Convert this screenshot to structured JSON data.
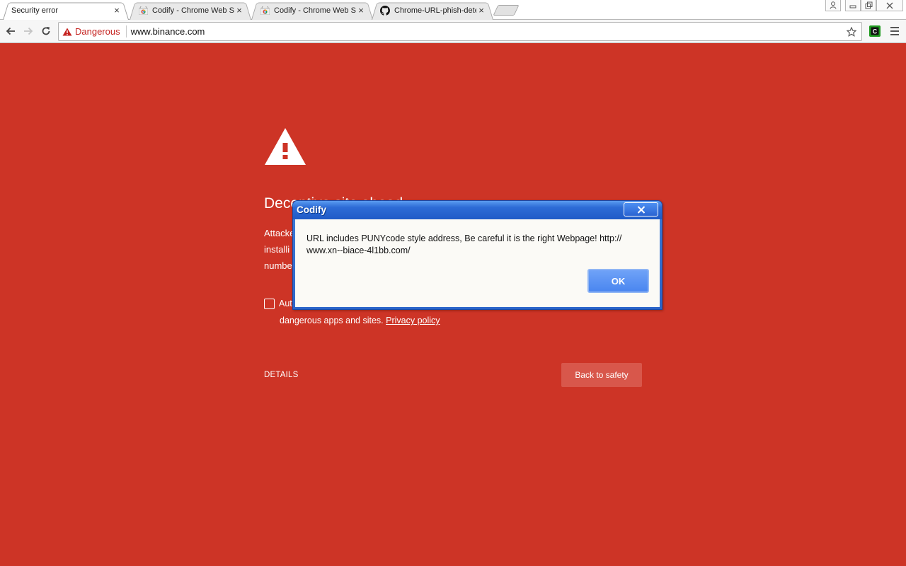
{
  "browser": {
    "tabs": [
      {
        "title": "Security error",
        "active": true
      },
      {
        "title": "Codify - Chrome Web Store",
        "active": false
      },
      {
        "title": "Codify - Chrome Web Store",
        "active": false
      },
      {
        "title": "Chrome-URL-phish-detector",
        "active": false
      }
    ],
    "tab_close_glyph": "×",
    "omnibox": {
      "security_label": "Dangerous",
      "url": "www.binance.com"
    },
    "extension_label": "C"
  },
  "interstitial": {
    "heading": "Deceptive site ahead",
    "body_lines": [
      "Attacke",
      "installi",
      "numbe"
    ],
    "checkbox_line1": "Aut",
    "checkbox_line2": "dangerous apps and sites.",
    "privacy_link": "Privacy policy",
    "details_label": "DETAILS",
    "safety_button": "Back to safety"
  },
  "dialog": {
    "title": "Codify",
    "message_line1": "URL includes PUNYcode style address, Be careful it is the right Webpage! http://",
    "message_line2": "www.xn--biace-4l1bb.com/",
    "ok_label": "OK"
  },
  "colors": {
    "interstitial_bg": "#cd3426",
    "danger_text": "#c5221f",
    "dialog_blue": "#2b64c9"
  },
  "icons": {
    "warning": "warning-triangle-icon",
    "back": "back-arrow-icon",
    "forward": "forward-arrow-icon",
    "reload": "reload-icon",
    "star": "bookmark-star-icon",
    "github": "github-icon",
    "webstore": "chrome-web-store-icon"
  }
}
